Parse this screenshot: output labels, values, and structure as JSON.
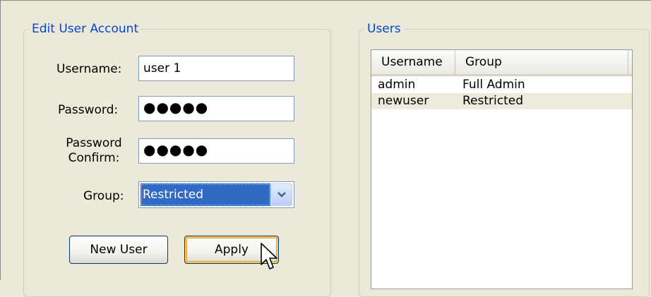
{
  "edit_account": {
    "title": "Edit User Account",
    "username_label": "Username:",
    "username_value": "user 1",
    "password_label": "Password:",
    "password_value": "●●●●●",
    "password_confirm_label_line1": "Password",
    "password_confirm_label_line2": "Confirm:",
    "password_confirm_value": "●●●●●",
    "group_label": "Group:",
    "group_selected": "Restricted",
    "new_user_button": "New User",
    "apply_button": "Apply"
  },
  "users": {
    "title": "Users",
    "columns": [
      "Username",
      "Group"
    ],
    "rows": [
      {
        "username": "admin",
        "group": "Full Admin"
      },
      {
        "username": "newuser",
        "group": "Restricted"
      }
    ]
  },
  "icons": {
    "dropdown": "chevron-down-icon",
    "cursor": "mouse-pointer-icon"
  },
  "colors": {
    "window_bg": "#ece9d8",
    "groupbox_title": "#0046d5",
    "selection": "#316ac5",
    "input_border": "#7f9db9",
    "alt_row": "#eeeadc"
  }
}
